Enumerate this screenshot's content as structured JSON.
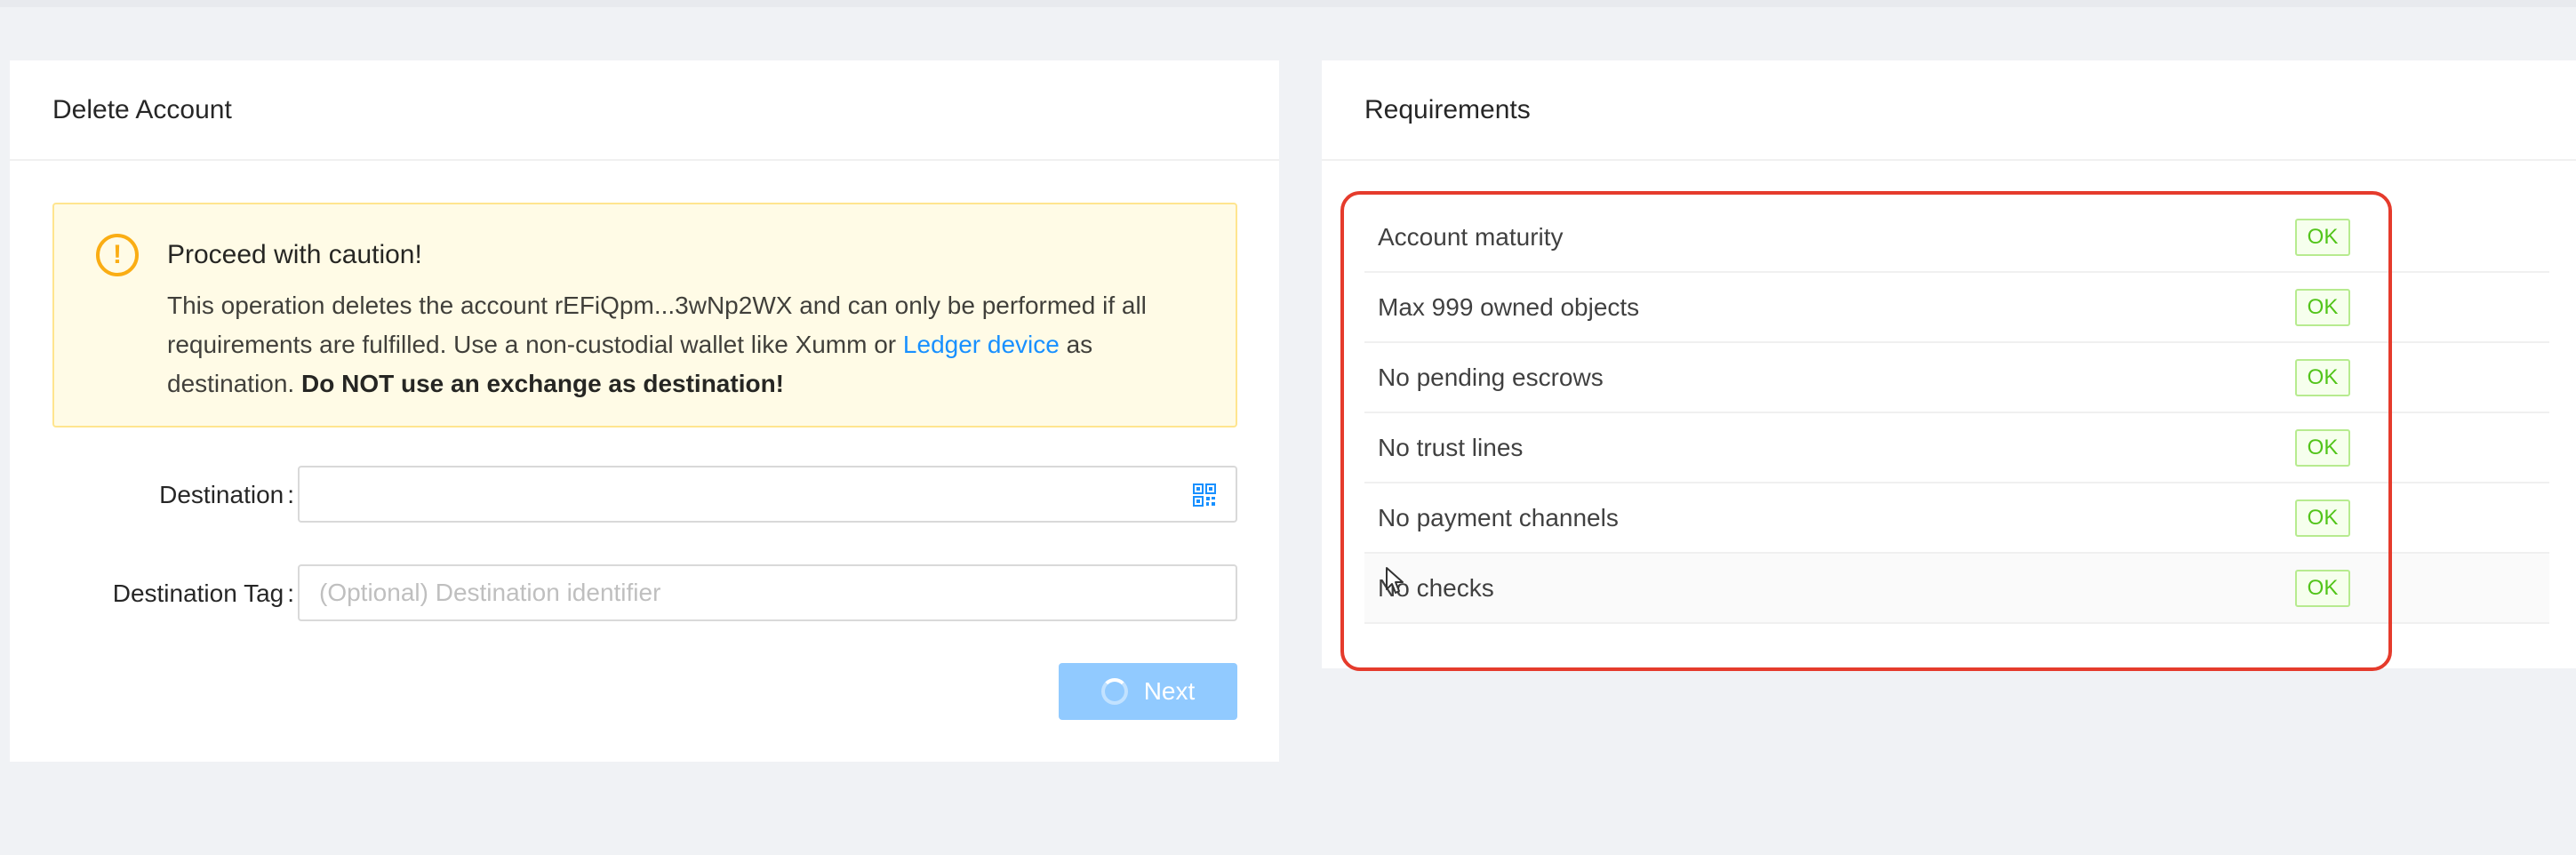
{
  "delete_account": {
    "title": "Delete Account",
    "alert": {
      "title": "Proceed with caution!",
      "text_part1": "This operation deletes the account rEFiQpm...3wNp2WX and can only be performed if all requirements are fulfilled. Use a non-custodial wallet like Xumm or ",
      "link_text": "Ledger device",
      "text_part2": " as destination. ",
      "bold_text": "Do NOT use an exchange as destination!"
    },
    "destination": {
      "label": "Destination",
      "value": "",
      "placeholder": ""
    },
    "destination_tag": {
      "label": "Destination Tag",
      "value": "",
      "placeholder": "(Optional) Destination identifier"
    },
    "next_button": "Next"
  },
  "requirements": {
    "title": "Requirements",
    "items": [
      {
        "label": "Account maturity",
        "status": "OK"
      },
      {
        "label": "Max 999 owned objects",
        "status": "OK"
      },
      {
        "label": "No pending escrows",
        "status": "OK"
      },
      {
        "label": "No trust lines",
        "status": "OK"
      },
      {
        "label": "No payment channels",
        "status": "OK"
      },
      {
        "label": "No checks",
        "status": "OK"
      }
    ]
  },
  "colors": {
    "accent": "#1890ff",
    "warning": "#faad14",
    "success": "#52c41a",
    "highlight": "#e53b2c"
  }
}
